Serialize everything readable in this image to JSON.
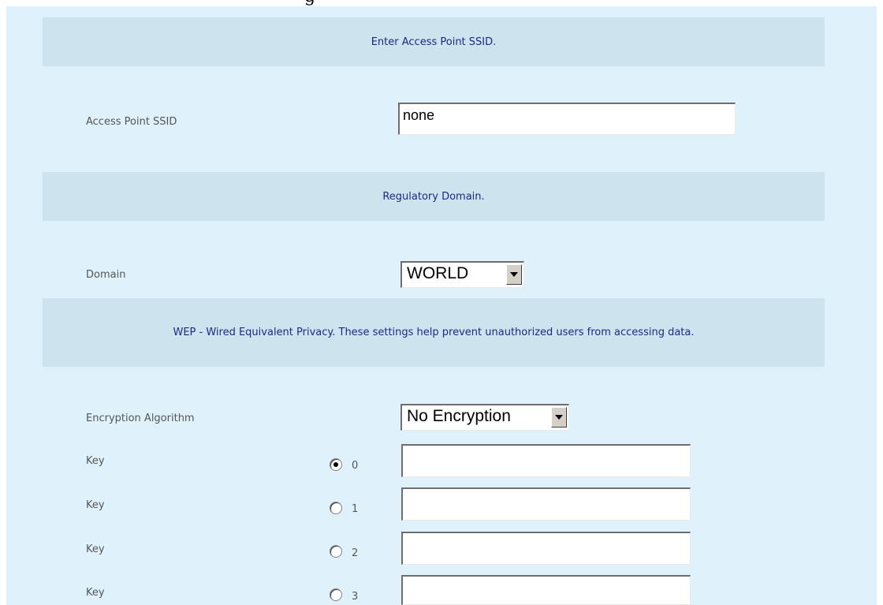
{
  "top_fragment": "g",
  "ssid_section": {
    "header": "Enter Access Point SSID.",
    "label": "Access Point SSID",
    "value": "none"
  },
  "domain_section": {
    "header": "Regulatory Domain.",
    "label": "Domain",
    "selected": "WORLD"
  },
  "wep_section": {
    "header": "WEP - Wired Equivalent Privacy. These settings help prevent unauthorized users from accessing data.",
    "algorithm_label": "Encryption Algorithm",
    "algorithm_selected": "No Encryption",
    "keys": [
      {
        "label": "Key",
        "index": "0",
        "value": "",
        "selected": true
      },
      {
        "label": "Key",
        "index": "1",
        "value": "",
        "selected": false
      },
      {
        "label": "Key",
        "index": "2",
        "value": "",
        "selected": false
      },
      {
        "label": "Key",
        "index": "3",
        "value": "",
        "selected": false
      }
    ]
  },
  "colors": {
    "panel_bg": "#dff1fb",
    "header_bg": "#cde3ee",
    "header_text": "#1a2a86"
  }
}
